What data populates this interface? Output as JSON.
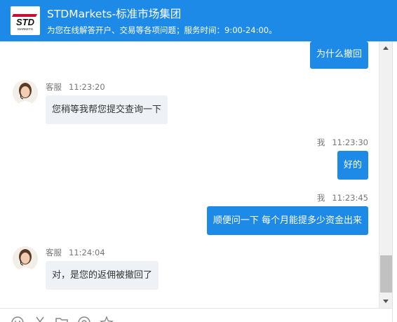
{
  "header": {
    "logo_text": "STD",
    "logo_subtext": "MARKETS",
    "title": "STDMarkets-标准市场集团",
    "subtitle": "为您在线解答开户、交易等各项问题；服务时间：9:00-24:00。"
  },
  "messages": [
    {
      "side": "out",
      "text": "为什么撤回"
    },
    {
      "side": "in",
      "sender": "客服",
      "time": "11:23:20",
      "text": "您稍等我帮您提交查询一下"
    },
    {
      "side": "out",
      "sender": "我",
      "time": "11:23:30",
      "text": "好的"
    },
    {
      "side": "out",
      "sender": "我",
      "time": "11:23:45",
      "text": "顺便问一下 每个月能提多少资金出来"
    },
    {
      "side": "in",
      "sender": "客服",
      "time": "11:24:04",
      "text": "对，是您的返佣被撤回了"
    }
  ],
  "toolbar": {
    "icons": [
      "emoji-icon",
      "scissors-icon",
      "folder-icon",
      "headset-icon",
      "star-icon"
    ]
  },
  "colors": {
    "brand": "#1e8ae8",
    "incoming_bubble": "#eef1f5",
    "meta_text": "#777777"
  }
}
